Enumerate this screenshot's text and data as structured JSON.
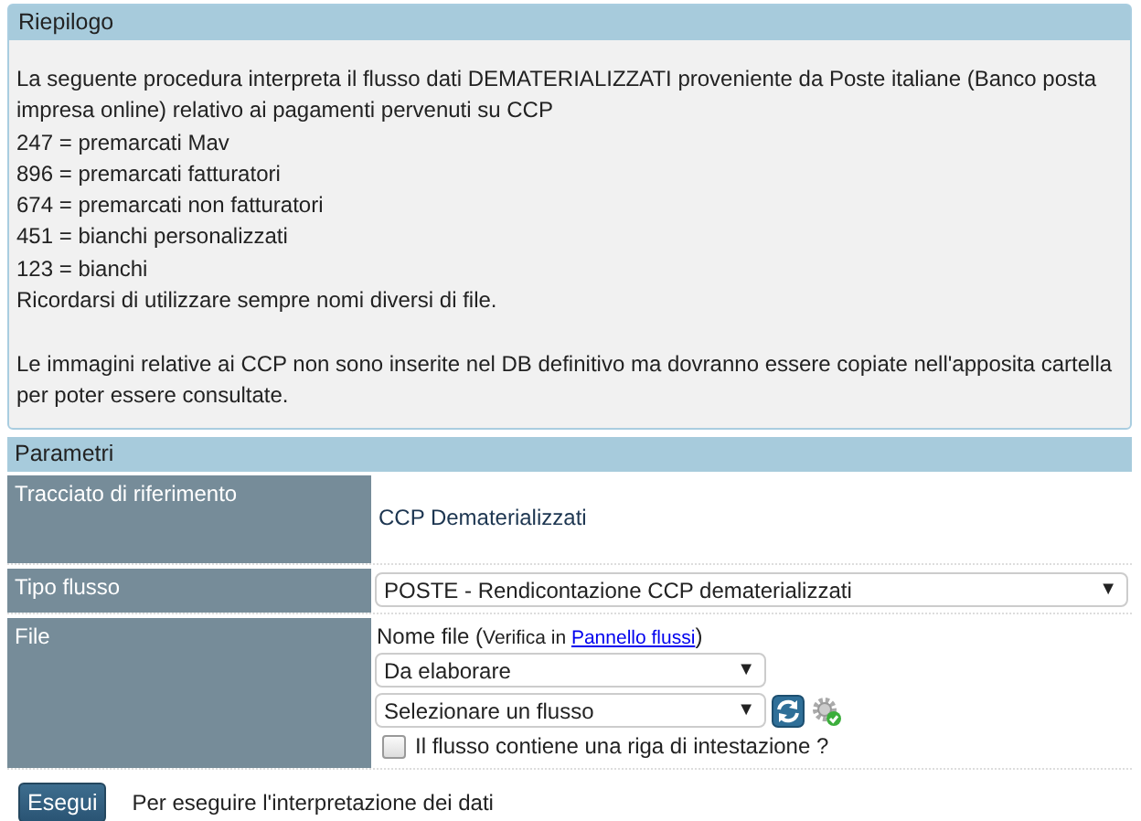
{
  "summary": {
    "title": "Riepilogo",
    "lines": [
      "La seguente procedura interpreta il flusso dati DEMATERIALIZZATI proveniente da Poste italiane (Banco posta impresa online) relativo ai pagamenti pervenuti su CCP",
      "247 = premarcati Mav",
      "896 = premarcati fatturatori",
      "674 = premarcati non fatturatori",
      "451 = bianchi personalizzati",
      "123 = bianchi",
      "Ricordarsi di utilizzare sempre nomi diversi di file."
    ],
    "note": "Le immagini relative ai CCP non sono inserite nel DB definitivo ma dovranno essere copiate nell'apposita cartella per poter essere consultate."
  },
  "params": {
    "title": "Parametri",
    "rows": [
      {
        "kind": "text",
        "label": "Tracciato di riferimento",
        "value": "CCP Dematerializzati"
      },
      {
        "kind": "select",
        "label": "Tipo flusso",
        "value": "POSTE - Rendicontazione CCP dematerializzati",
        "arrow": "▼"
      },
      {
        "kind": "file",
        "label": "File",
        "caption": "Nome file (",
        "hint": "Verifica in",
        "link": "Pannello flussi",
        "caption_end": ")",
        "selects": [
          {
            "value": "Da elaborare",
            "arrow": "▼"
          },
          {
            "value": "Selezionare un flusso",
            "arrow": "▼"
          }
        ],
        "checkbox": {
          "label": "Il flusso contiene una riga di intestazione ?",
          "checked": false
        }
      }
    ]
  },
  "action": {
    "button": "Esegui",
    "description": "Per eseguire l'interpretazione dei dati"
  }
}
